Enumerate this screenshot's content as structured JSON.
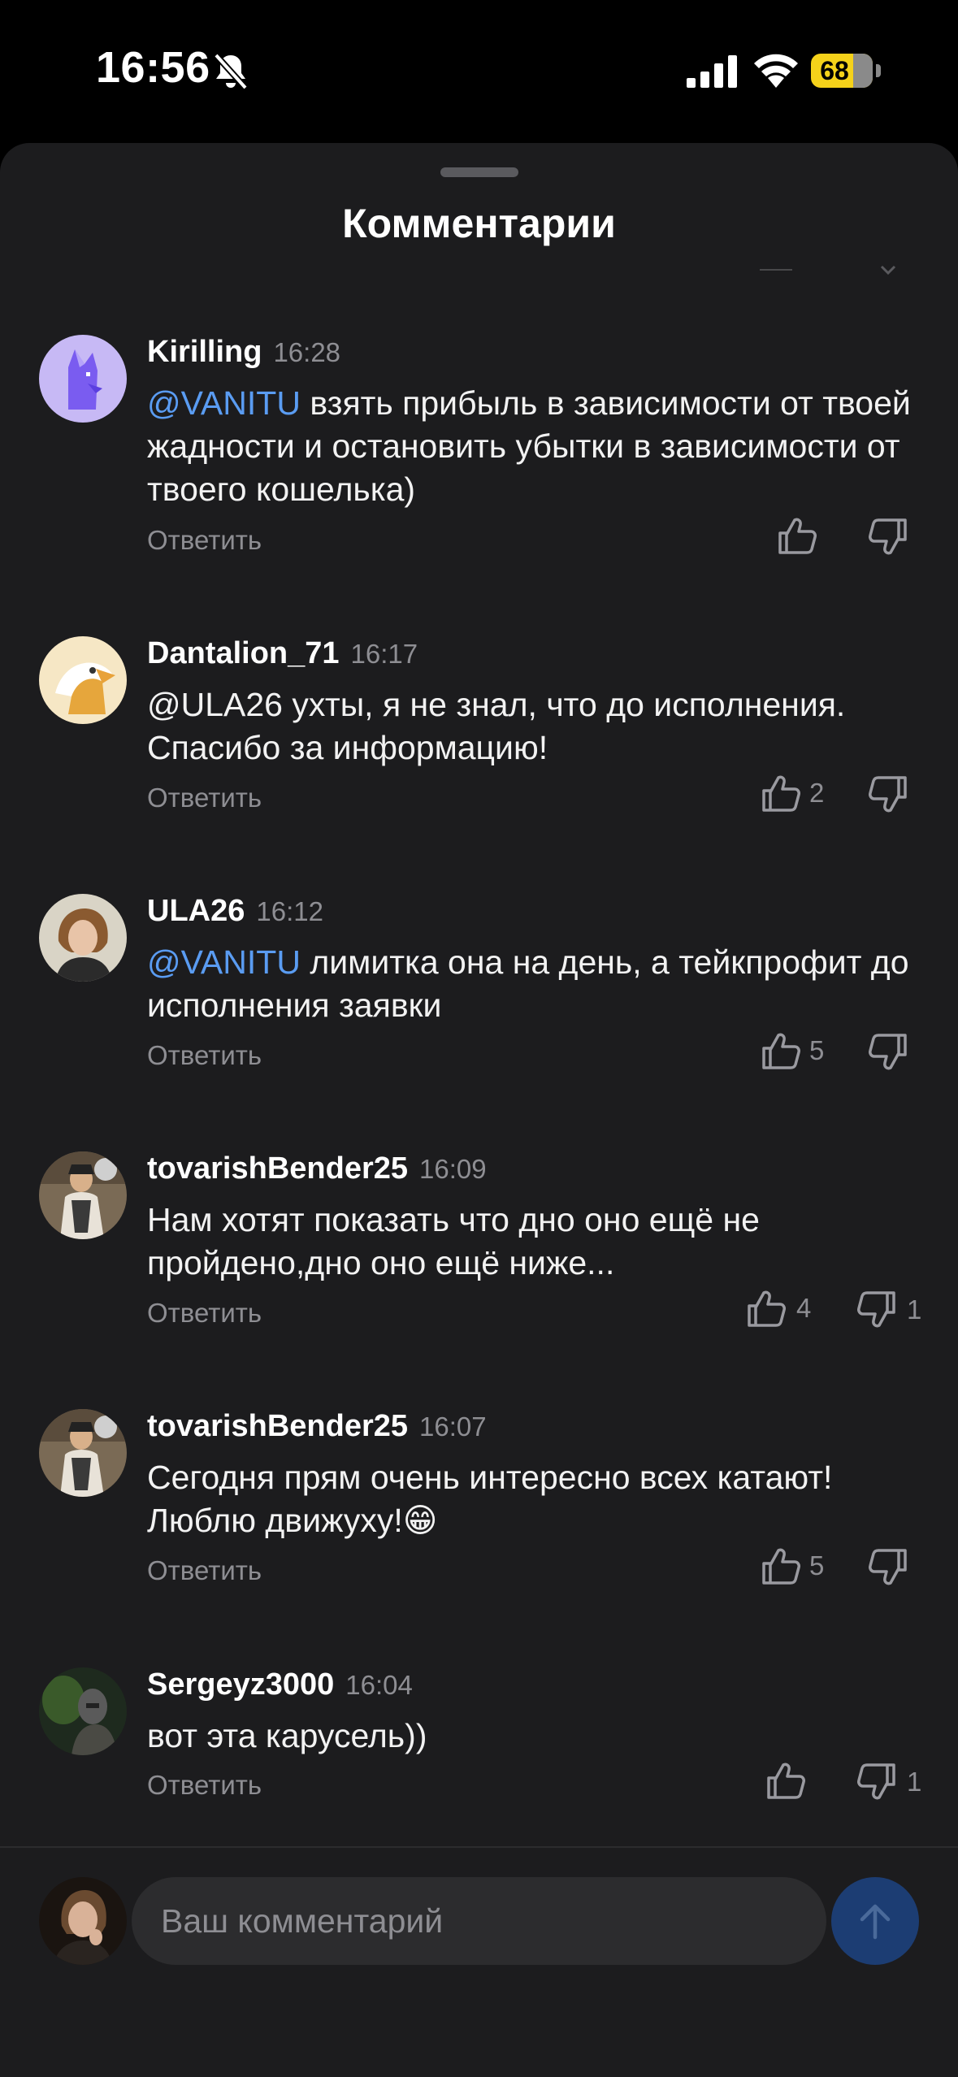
{
  "status_bar": {
    "time": "16:56",
    "battery": "68"
  },
  "sheet": {
    "title": "Комментарии"
  },
  "actions": {
    "reply_label": "Ответить"
  },
  "comments": [
    {
      "author": "Kirilling",
      "time": "16:28",
      "mention": "@VANITU",
      "text": " взять прибыль в зависимости от твоей жадности и остановить убытки в зависимости от твоего кошелька)",
      "likes": "",
      "dislikes": ""
    },
    {
      "author": "Dantalion_71",
      "time": "16:17",
      "mention": "",
      "text": "@ULA26 ухты, я не знал, что до исполнения. Спасибо за информацию!",
      "likes": "2",
      "dislikes": ""
    },
    {
      "author": "ULA26",
      "time": "16:12",
      "mention": "@VANITU",
      "text": " лимитка она на день, а тейкпрофит до исполнения заявки",
      "likes": "5",
      "dislikes": ""
    },
    {
      "author": "tovarishBender25",
      "time": "16:09",
      "mention": "",
      "text": "Нам хотят показать что дно оно ещё не пройдено,дно оно ещё ниже...",
      "likes": "4",
      "dislikes": "1"
    },
    {
      "author": "tovarishBender25",
      "time": "16:07",
      "mention": "",
      "text": "Сегодня прям очень интересно всех катают! Люблю движуху!😁",
      "likes": "5",
      "dislikes": ""
    },
    {
      "author": "Sergeyz3000",
      "time": "16:04",
      "mention": "",
      "text": "вот эта карусель))",
      "likes": "",
      "dislikes": "1"
    }
  ],
  "composer": {
    "placeholder": "Ваш комментарий"
  },
  "colors": {
    "background": "#1c1c1e",
    "mention": "#5a9cf2",
    "send_button": "#1c3d73",
    "battery": "#f5d21a"
  }
}
